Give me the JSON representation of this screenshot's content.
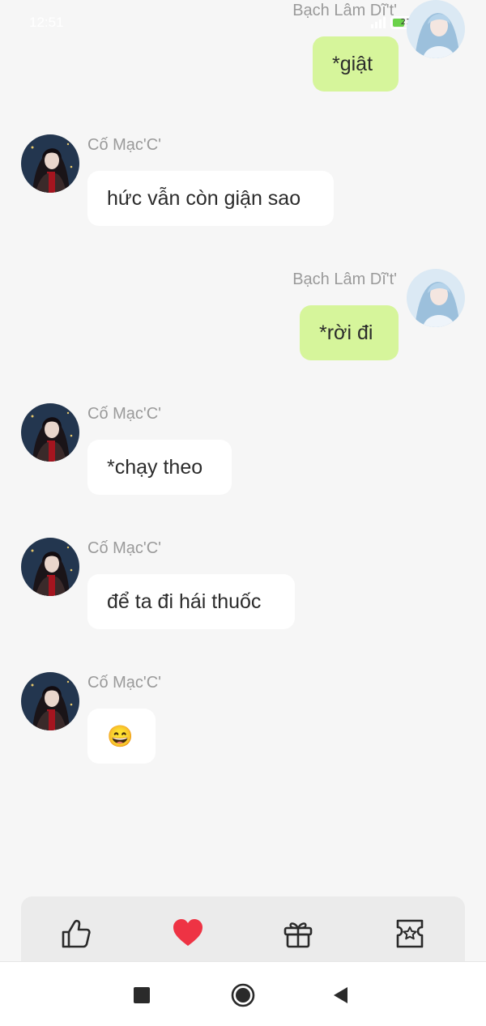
{
  "status_bar": {
    "time": "12:51",
    "battery": "21"
  },
  "messages": [
    {
      "sender": "Bạch Lâm Dĩ't'",
      "side": "out",
      "text": "*giật"
    },
    {
      "sender": "Cố Mạc'C'",
      "side": "in",
      "text": "hức vẫn còn giận sao"
    },
    {
      "sender": "Bạch Lâm Dĩ't'",
      "side": "out",
      "text": "*rời đi"
    },
    {
      "sender": "Cố Mạc'C'",
      "side": "in",
      "text": "*chạy theo"
    },
    {
      "sender": "Cố Mạc'C'",
      "side": "in",
      "text": "để ta đi hái thuốc"
    },
    {
      "sender": "Cố Mạc'C'",
      "side": "in",
      "text": "😄"
    }
  ],
  "action_bar": {
    "icons": [
      "thumbs-up-icon",
      "heart-icon",
      "gift-icon",
      "ticket-star-icon"
    ]
  },
  "nav_bar": {
    "icons": [
      "recent-apps-icon",
      "home-icon",
      "back-icon"
    ]
  },
  "colors": {
    "background": "#f6f6f6",
    "incoming_bubble": "#ffffff",
    "outgoing_bubble": "#d6f59b",
    "heart": "#ee3344",
    "name": "#9a9a9a"
  }
}
